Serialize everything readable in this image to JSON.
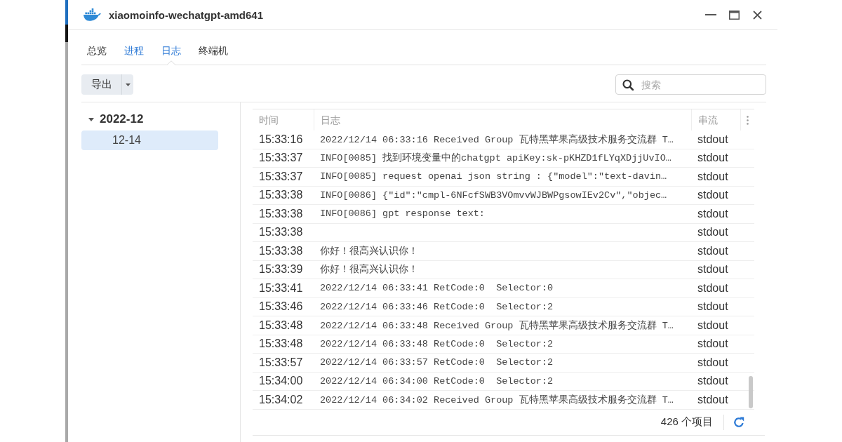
{
  "window": {
    "title": "xiaomoinfo-wechatgpt-amd641"
  },
  "tabs": [
    {
      "label": "总览",
      "selected": false,
      "hovered": false
    },
    {
      "label": "进程",
      "selected": false,
      "hovered": true
    },
    {
      "label": "日志",
      "selected": true,
      "hovered": false
    },
    {
      "label": "终端机",
      "selected": false,
      "hovered": false
    }
  ],
  "toolbar": {
    "export_button": "导出",
    "search": {
      "placeholder": "搜索"
    }
  },
  "tree": [
    {
      "label": "2022-12",
      "expanded": true,
      "children": [
        {
          "label": "12-14",
          "selected": true
        }
      ]
    }
  ],
  "table": {
    "columns": [
      "时间",
      "日志",
      "串流"
    ],
    "rows": [
      {
        "time": "15:33:16",
        "message": "2022/12/14 06:33:16 Received Group 瓦特黑苹果高级技术服务交流群 T…",
        "stream": "stdout"
      },
      {
        "time": "15:33:37",
        "message": "INFO[0085] 找到环境变量中的chatgpt apiKey:sk-pKHZD1fLYqXDjjUvIO…",
        "stream": "stdout"
      },
      {
        "time": "15:33:37",
        "message": "INFO[0085] request openai json string : {\"model\":\"text-davin…",
        "stream": "stdout"
      },
      {
        "time": "15:33:38",
        "message": "INFO[0086] {\"id\":\"cmpl-6NFcfSWB3VOmvvWJBWPgsowIEv2Cv\",\"objec…",
        "stream": "stdout"
      },
      {
        "time": "15:33:38",
        "message": "INFO[0086] gpt response text:",
        "stream": "stdout"
      },
      {
        "time": "15:33:38",
        "stream": "stdout"
      },
      {
        "time": "15:33:38",
        "message": "你好！很高兴认识你！",
        "stream": "stdout"
      },
      {
        "time": "15:33:39",
        "message": "你好！很高兴认识你！",
        "stream": "stdout"
      },
      {
        "time": "15:33:41",
        "message": "2022/12/14 06:33:41 RetCode:0  Selector:0",
        "stream": "stdout"
      },
      {
        "time": "15:33:46",
        "message": "2022/12/14 06:33:46 RetCode:0  Selector:2",
        "stream": "stdout"
      },
      {
        "time": "15:33:48",
        "message": "2022/12/14 06:33:48 Received Group 瓦特黑苹果高级技术服务交流群 T…",
        "stream": "stdout"
      },
      {
        "time": "15:33:48",
        "message": "2022/12/14 06:33:48 RetCode:0  Selector:2",
        "stream": "stdout"
      },
      {
        "time": "15:33:57",
        "message": "2022/12/14 06:33:57 RetCode:0  Selector:2",
        "stream": "stdout"
      },
      {
        "time": "15:34:00",
        "message": "2022/12/14 06:34:00 RetCode:0  Selector:2",
        "stream": "stdout"
      },
      {
        "time": "15:34:02",
        "message": "2022/12/14 06:34:02 Received Group 瓦特黑苹果高级技术服务交流群 T…",
        "stream": "stdout"
      }
    ]
  },
  "footer": {
    "count": "426 个项目"
  }
}
